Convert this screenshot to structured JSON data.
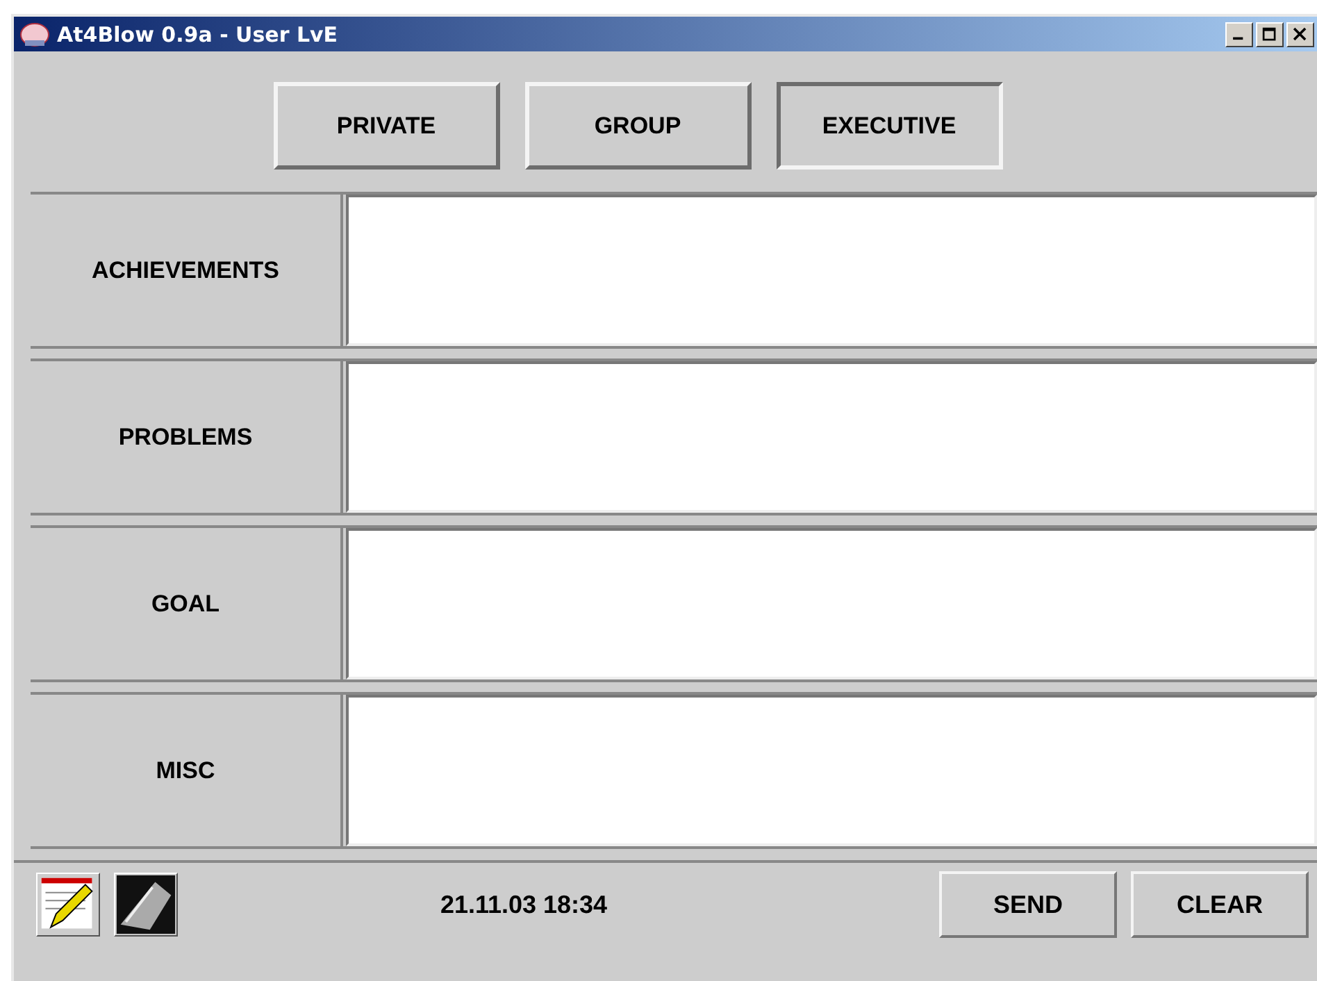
{
  "window": {
    "title": "At4Blow 0.9a - User LvE"
  },
  "tabs": [
    {
      "label": "PRIVATE",
      "selected": false
    },
    {
      "label": "GROUP",
      "selected": false
    },
    {
      "label": "EXECUTIVE",
      "selected": true
    }
  ],
  "sections": [
    {
      "label": "ACHIEVEMENTS"
    },
    {
      "label": "PROBLEMS"
    },
    {
      "label": "GOAL"
    },
    {
      "label": "MISC"
    }
  ],
  "status_bar": {
    "timestamp": "21.11.03 18:34",
    "buttons": [
      "SEND",
      "CLEAR"
    ]
  }
}
